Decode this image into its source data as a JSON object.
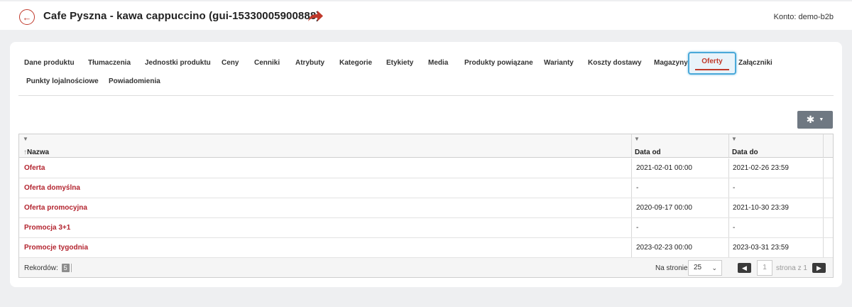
{
  "header": {
    "back_icon": "arrow-left-icon",
    "title": "Cafe Pyszna - kawa cappuccino (gui-15330005900888)",
    "share_icon": "share-arrow-icon",
    "account": "Konto: demo-b2b"
  },
  "tabs": [
    {
      "label": "Dane produktu"
    },
    {
      "label": "Tłumaczenia"
    },
    {
      "label": "Jednostki produktu"
    },
    {
      "label": "Ceny"
    },
    {
      "label": "Cenniki"
    },
    {
      "label": "Atrybuty"
    },
    {
      "label": "Kategorie"
    },
    {
      "label": "Etykiety"
    },
    {
      "label": "Media"
    },
    {
      "label": "Produkty powiązane"
    },
    {
      "label": "Warianty"
    },
    {
      "label": "Koszty dostawy"
    },
    {
      "label": "Magazyny"
    },
    {
      "label": "Oferty",
      "active": true
    },
    {
      "label": "Załączniki"
    },
    {
      "label": "Punkty lojalnościowe"
    },
    {
      "label": "Powiadomienia"
    }
  ],
  "toolbar": {
    "settings_icon": "gear-icon",
    "caret_icon": "caret-down-icon"
  },
  "grid": {
    "columns": [
      {
        "label": "Nazwa",
        "sorted": "asc",
        "sort_icon": "sort-up-icon",
        "filter_icon": "filter-icon"
      },
      {
        "label": "Data od",
        "filter_icon": "filter-icon"
      },
      {
        "label": "Data do",
        "filter_icon": "filter-icon"
      }
    ],
    "rows": [
      {
        "name": "Oferta",
        "date_from": "2021-02-01 00:00",
        "date_to": "2021-02-26 23:59"
      },
      {
        "name": "Oferta domyślna",
        "date_from": "-",
        "date_to": "-"
      },
      {
        "name": "Oferta promocyjna",
        "date_from": "2020-09-17 00:00",
        "date_to": "2021-10-30 23:39"
      },
      {
        "name": "Promocja 3+1",
        "date_from": "-",
        "date_to": "-"
      },
      {
        "name": "Promocje tygodnia",
        "date_from": "2023-02-23 00:00",
        "date_to": "2023-03-31 23:59"
      }
    ],
    "footer": {
      "records_label": "Rekordów:",
      "records_count": "5",
      "per_page_label": "Na stronie",
      "per_page_value": "25",
      "page_value": "1",
      "page_of": "strona z 1",
      "prev_icon": "chevron-left-icon",
      "next_icon": "chevron-right-icon"
    }
  },
  "colors": {
    "accent": "#c0392b",
    "active_tab_border": "#4aa9d9",
    "link": "#b3242f"
  }
}
